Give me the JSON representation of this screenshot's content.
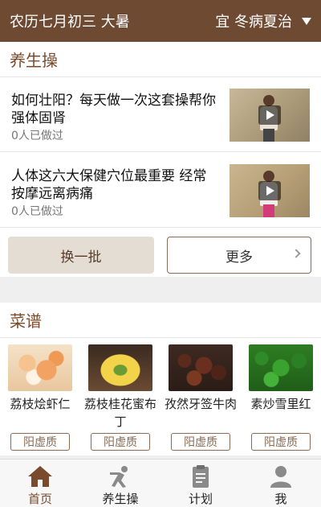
{
  "header": {
    "date": "农历七月初三  大暑",
    "advice": "宜 冬病夏治"
  },
  "exercise_section": {
    "title": "养生操",
    "articles": [
      {
        "title": "如何壮阳？每天做一次这套操帮你强体固肾",
        "count": "0人已做过"
      },
      {
        "title": "人体这六大保健穴位最重要 经常按摩远离病痛",
        "count": "0人已做过"
      }
    ],
    "swap_label": "换一批",
    "more_label": "更多"
  },
  "recipe_section": {
    "title": "菜谱",
    "items": [
      {
        "name": "荔枝烩虾仁",
        "tag": "阳虚质"
      },
      {
        "name": "荔枝桂花蜜布丁",
        "tag": "阳虚质"
      },
      {
        "name": "孜然牙签牛肉",
        "tag": "阳虚质"
      },
      {
        "name": "素炒雪里红",
        "tag": "阳虚质"
      }
    ]
  },
  "tabbar": {
    "items": [
      {
        "label": "首页",
        "icon": "home-icon",
        "active": true
      },
      {
        "label": "养生操",
        "icon": "exercise-icon",
        "active": false
      },
      {
        "label": "计划",
        "icon": "clipboard-icon",
        "active": false
      },
      {
        "label": "我",
        "icon": "user-icon",
        "active": false
      }
    ]
  },
  "colors": {
    "brand": "#6e4a33",
    "accent_text": "#7a4a2c"
  }
}
